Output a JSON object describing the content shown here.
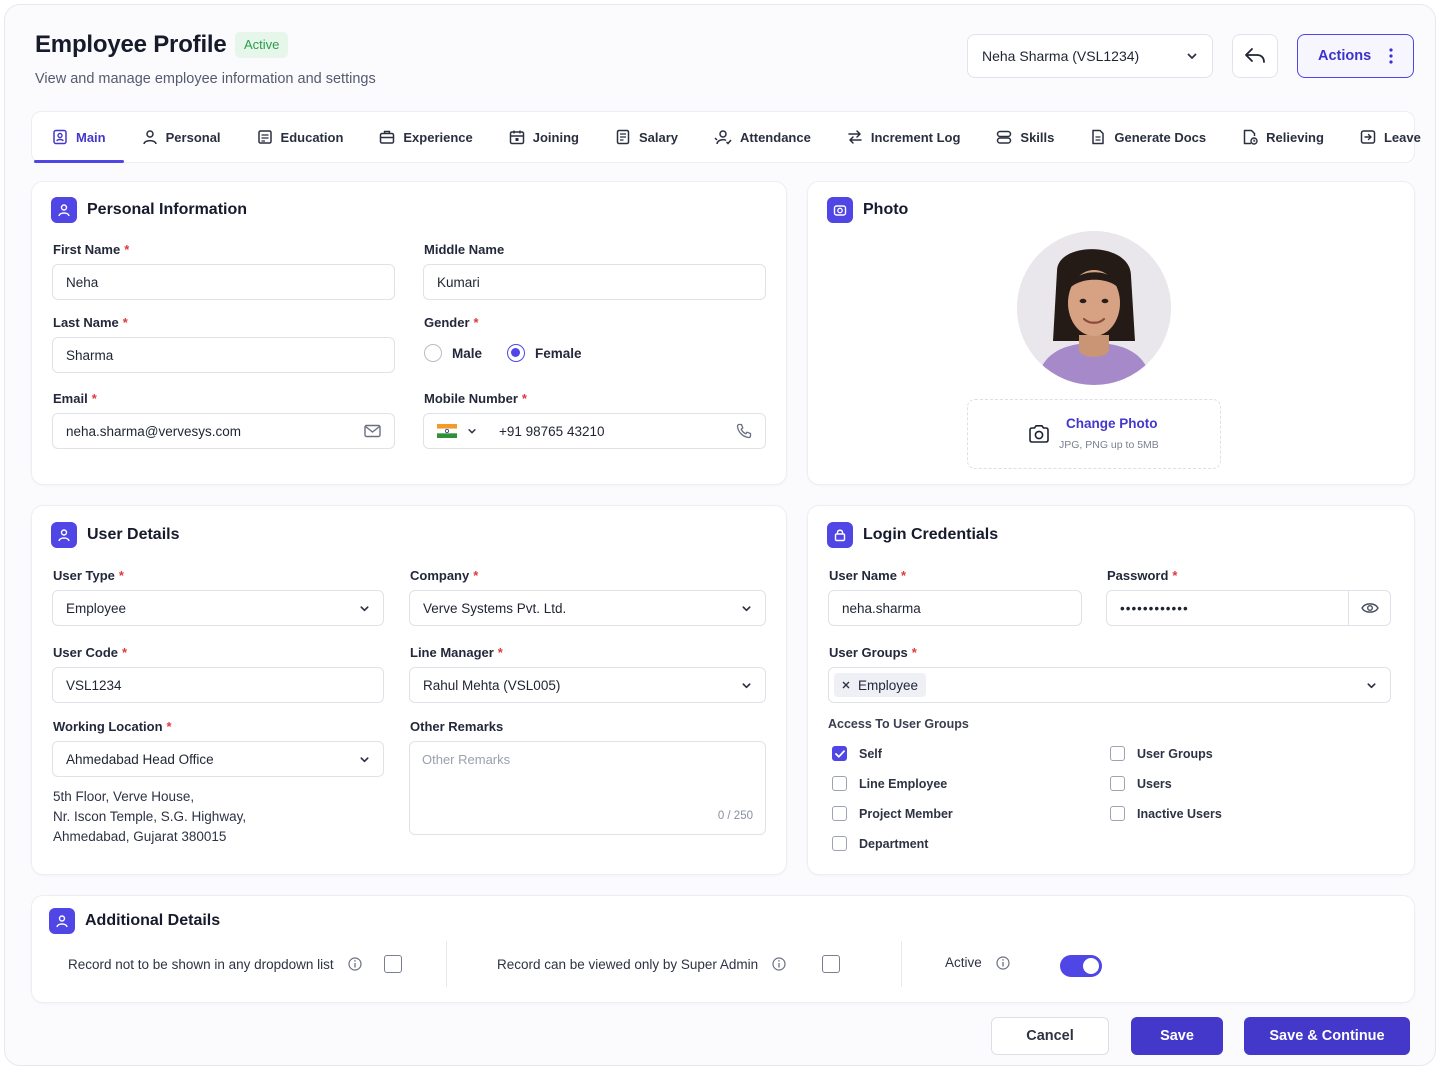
{
  "header": {
    "title": "Employee Profile",
    "status": "Active",
    "subtitle": "View and manage employee information and settings",
    "employee_select": "Neha Sharma (VSL1234)",
    "actions_label": "Actions"
  },
  "tabs": [
    {
      "label": "Main",
      "icon": "user-badge-icon",
      "active": true
    },
    {
      "label": "Personal",
      "icon": "person-icon"
    },
    {
      "label": "Education",
      "icon": "graduation-cap-icon"
    },
    {
      "label": "Experience",
      "icon": "briefcase-icon"
    },
    {
      "label": "Joining",
      "icon": "calendar-icon"
    },
    {
      "label": "Salary",
      "icon": "document-money-icon"
    },
    {
      "label": "Attendance",
      "icon": "user-check-icon"
    },
    {
      "label": "Increment Log",
      "icon": "arrows-swap-icon"
    },
    {
      "label": "Skills",
      "icon": "layers-icon"
    },
    {
      "label": "Generate Docs",
      "icon": "file-text-icon"
    },
    {
      "label": "Relieving",
      "icon": "file-clock-icon"
    },
    {
      "label": "Leave",
      "icon": "exit-icon"
    }
  ],
  "personal": {
    "title": "Personal Information",
    "first_name_label": "First Name",
    "first_name": "Neha",
    "middle_name_label": "Middle Name",
    "middle_name": "Kumari",
    "last_name_label": "Last Name",
    "last_name": "Sharma",
    "gender_label": "Gender",
    "gender_options": [
      "Male",
      "Female"
    ],
    "gender_selected": "Female",
    "email_label": "Email",
    "email": "neha.sharma@vervesys.com",
    "mobile_label": "Mobile Number",
    "mobile": "+91 98765 43210"
  },
  "photo": {
    "title": "Photo",
    "change_label": "Change Photo",
    "hint": "JPG, PNG up to 5MB"
  },
  "user_details": {
    "title": "User Details",
    "user_type_label": "User Type",
    "user_type": "Employee",
    "company_label": "Company",
    "company": "Verve Systems Pvt. Ltd.",
    "user_code_label": "User Code",
    "user_code": "VSL1234",
    "line_manager_label": "Line Manager",
    "line_manager": "Rahul Mehta (VSL005)",
    "location_label": "Working Location",
    "location": "Ahmedabad Head Office",
    "address_line1": "5th Floor, Verve House,",
    "address_line2": "Nr. Iscon Temple, S.G. Highway,",
    "address_line3": "Ahmedabad, Gujarat 380015",
    "remarks_label": "Other Remarks",
    "remarks_placeholder": "Other Remarks",
    "remarks_counter": "0 / 250"
  },
  "login": {
    "title": "Login Credentials",
    "username_label": "User Name",
    "username": "neha.sharma",
    "password_label": "Password",
    "password": "••••••••••••",
    "groups_label": "User Groups",
    "group_tag": "Employee",
    "access_label": "Access To User Groups",
    "access_left": [
      {
        "label": "Self",
        "checked": true
      },
      {
        "label": "Line Employee",
        "checked": false
      },
      {
        "label": "Project Member",
        "checked": false
      },
      {
        "label": "Department",
        "checked": false
      }
    ],
    "access_right": [
      {
        "label": "User Groups",
        "checked": false
      },
      {
        "label": "Users",
        "checked": false
      },
      {
        "label": "Inactive Users",
        "checked": false
      }
    ]
  },
  "additional": {
    "title": "Additional Details",
    "hide_dropdown_label": "Record not to be shown in any dropdown list",
    "super_admin_label": "Record can be viewed only by Super Admin",
    "active_label": "Active",
    "active_on": true
  },
  "footer": {
    "cancel": "Cancel",
    "save": "Save",
    "save_continue": "Save & Continue"
  },
  "colors": {
    "accent": "#4f46e5",
    "status_green": "#2a9d4b",
    "required": "#e0383e"
  }
}
